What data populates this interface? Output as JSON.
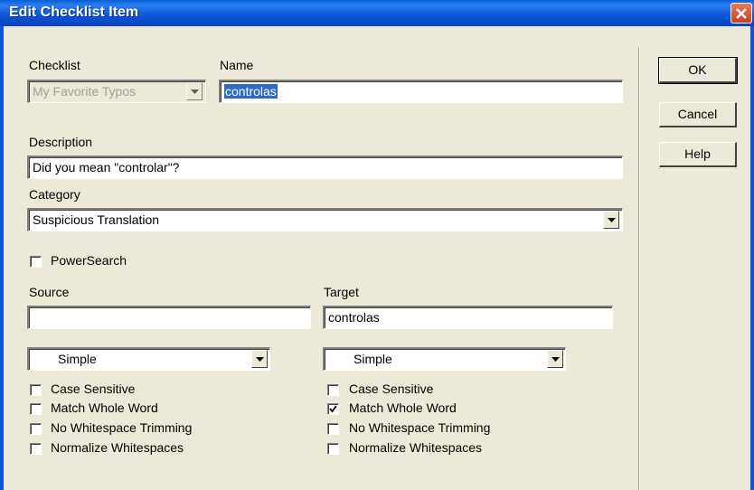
{
  "window": {
    "title": "Edit Checklist Item"
  },
  "fields": {
    "checklist_label": "Checklist",
    "checklist_value": "My Favorite Typos",
    "name_label": "Name",
    "name_value": "controlas",
    "description_label": "Description",
    "description_value": "Did you mean \"controlar\"?",
    "category_label": "Category",
    "category_value": "Suspicious Translation",
    "powersearch_label": "PowerSearch",
    "source_label": "Source",
    "source_value": "",
    "target_label": "Target",
    "target_value": "controlas"
  },
  "buttons": {
    "ok": "OK",
    "cancel": "Cancel",
    "help": "Help"
  },
  "source_options": {
    "mode": "Simple",
    "checks": [
      {
        "label": "Case Sensitive",
        "checked": false
      },
      {
        "label": "Match Whole Word",
        "checked": false
      },
      {
        "label": "No Whitespace Trimming",
        "checked": false
      },
      {
        "label": "Normalize Whitespaces",
        "checked": false
      }
    ]
  },
  "target_options": {
    "mode": "Simple",
    "checks": [
      {
        "label": "Case Sensitive",
        "checked": false
      },
      {
        "label": "Match Whole Word",
        "checked": true
      },
      {
        "label": "No Whitespace Trimming",
        "checked": false
      },
      {
        "label": "Normalize Whitespaces",
        "checked": false
      }
    ]
  },
  "colors": {
    "titlebar": "#0b55d6",
    "background": "#ece9d8",
    "selection": "#316ac5"
  }
}
